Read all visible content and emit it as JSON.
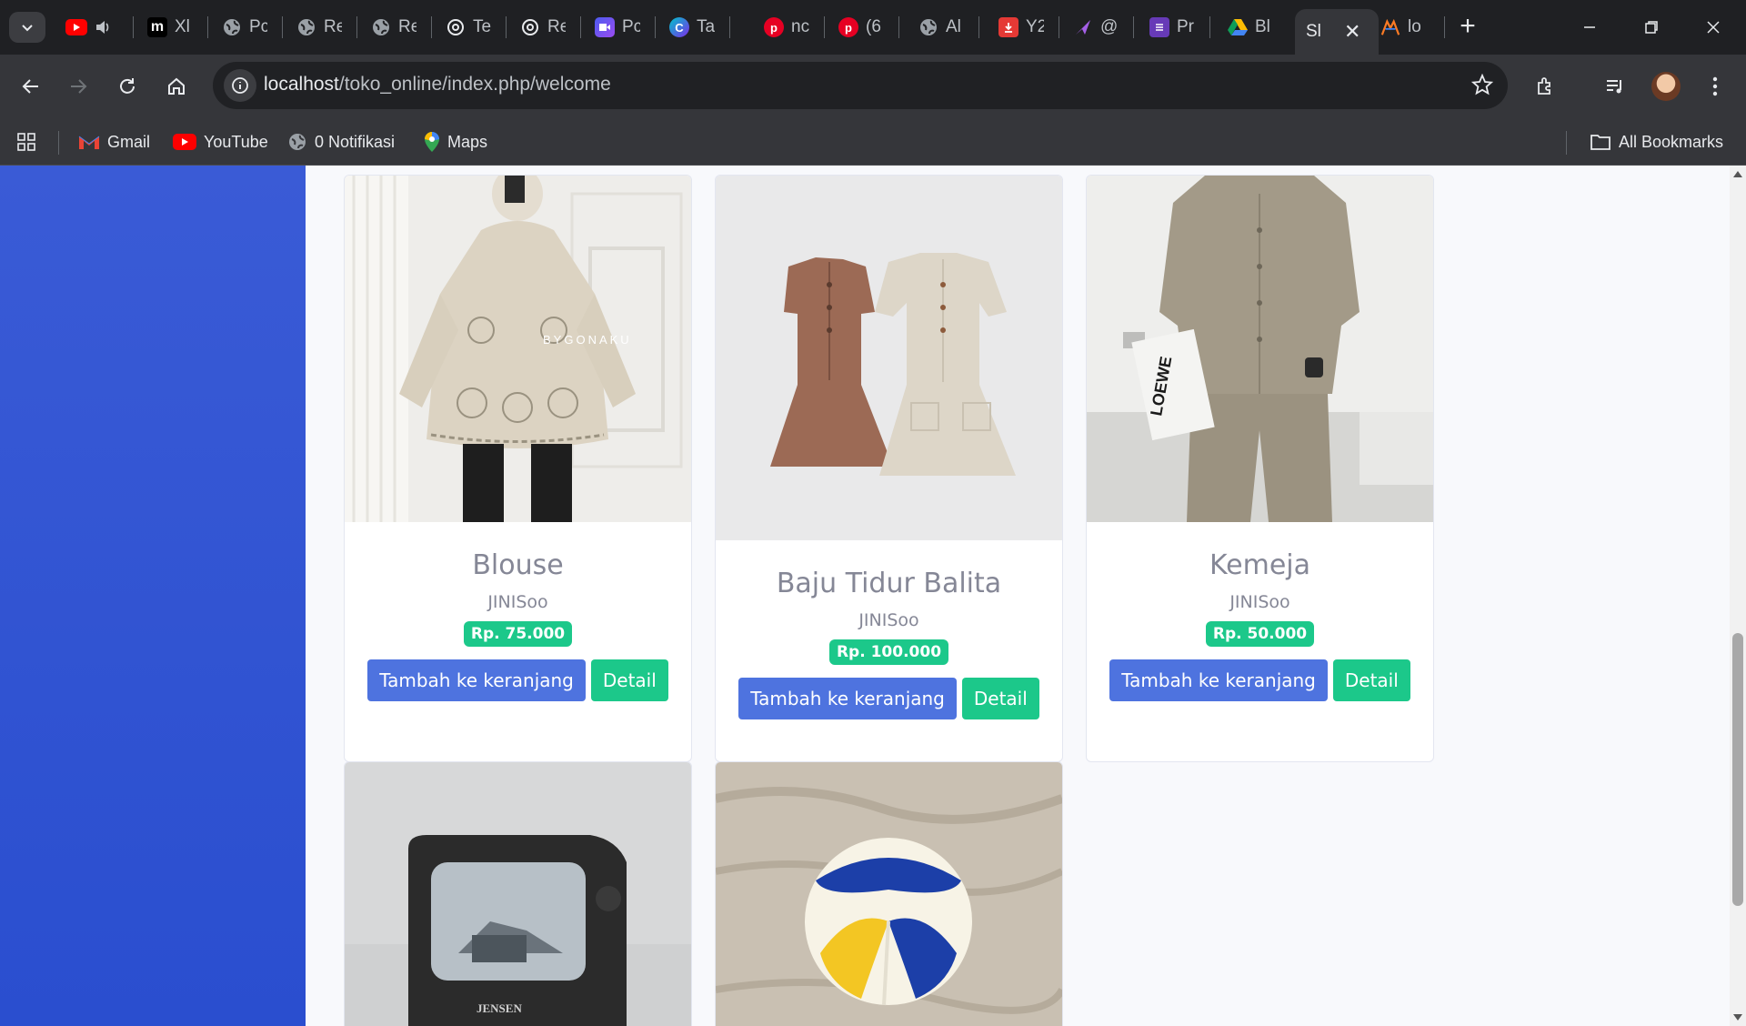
{
  "browser": {
    "tabs": [
      {
        "label": "Xl",
        "icon": "medium-icon"
      },
      {
        "label": "Pc",
        "icon": "globe-icon"
      },
      {
        "label": "Re",
        "icon": "globe-icon"
      },
      {
        "label": "Re",
        "icon": "globe-icon"
      },
      {
        "label": "Te",
        "icon": "openai-icon"
      },
      {
        "label": "Re",
        "icon": "openai-icon"
      },
      {
        "label": "Pc",
        "icon": "video-icon"
      },
      {
        "label": "Ta",
        "icon": "canva-icon"
      },
      {
        "label": "nc",
        "icon": "pinterest-icon"
      },
      {
        "label": "(6",
        "icon": "pinterest-icon"
      },
      {
        "label": "Al",
        "icon": "globe-icon"
      },
      {
        "label": "Y2",
        "icon": "download-icon"
      },
      {
        "label": "@",
        "icon": "send-icon"
      },
      {
        "label": "Pr",
        "icon": "list-icon"
      },
      {
        "label": "Bl",
        "icon": "drive-icon"
      },
      {
        "label": "Sl",
        "icon": "none",
        "active": true
      },
      {
        "label": "lo",
        "icon": "xampp-icon"
      }
    ],
    "url": {
      "host": "localhost",
      "path": "/toko_online/index.php/welcome"
    },
    "bookmarks": [
      {
        "label": "Gmail",
        "icon": "gmail-icon"
      },
      {
        "label": "YouTube",
        "icon": "youtube-icon"
      },
      {
        "label": "0 Notifikasi",
        "icon": "globe-icon"
      },
      {
        "label": "Maps",
        "icon": "maps-icon"
      }
    ],
    "all_bookmarks": "All Bookmarks"
  },
  "products": [
    {
      "name": "Blouse",
      "brand": "JINISoo",
      "price": "Rp. 75.000",
      "add_label": "Tambah ke keranjang",
      "detail_label": "Detail",
      "image": "blouse-photo",
      "watermark": "BYGONAKU"
    },
    {
      "name": "Baju Tidur Balita",
      "brand": "JINISoo",
      "price": "Rp. 100.000",
      "add_label": "Tambah ke keranjang",
      "detail_label": "Detail",
      "image": "baby-pajama-photo"
    },
    {
      "name": "Kemeja",
      "brand": "JINISoo",
      "price": "Rp. 50.000",
      "add_label": "Tambah ke keranjang",
      "detail_label": "Detail",
      "image": "shirt-photo",
      "magazine_text": "LOEWE"
    },
    {
      "image": "tv-photo",
      "tv_brand": "JENSEN"
    },
    {
      "image": "volleyball-photo"
    }
  ],
  "colors": {
    "sidebar": "#2f52d3",
    "primary": "#4e73df",
    "success": "#1cc88a"
  }
}
